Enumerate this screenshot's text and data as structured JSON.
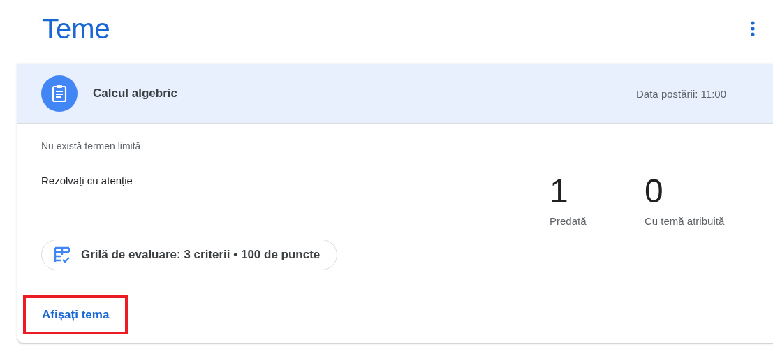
{
  "page": {
    "title": "Teme"
  },
  "assignment": {
    "title": "Calcul algebric",
    "posted": "Data postării: 11:00",
    "due": "Nu există termen limită",
    "instructions": "Rezolvați cu atenție",
    "stats": [
      {
        "value": "1",
        "label": "Predată"
      },
      {
        "value": "0",
        "label": "Cu temă atribuită"
      }
    ],
    "rubric": "Grilă de evaluare: 3 criterii • 100 de puncte",
    "link": {
      "label": "Afișați tema",
      "highlighted": true
    }
  }
}
